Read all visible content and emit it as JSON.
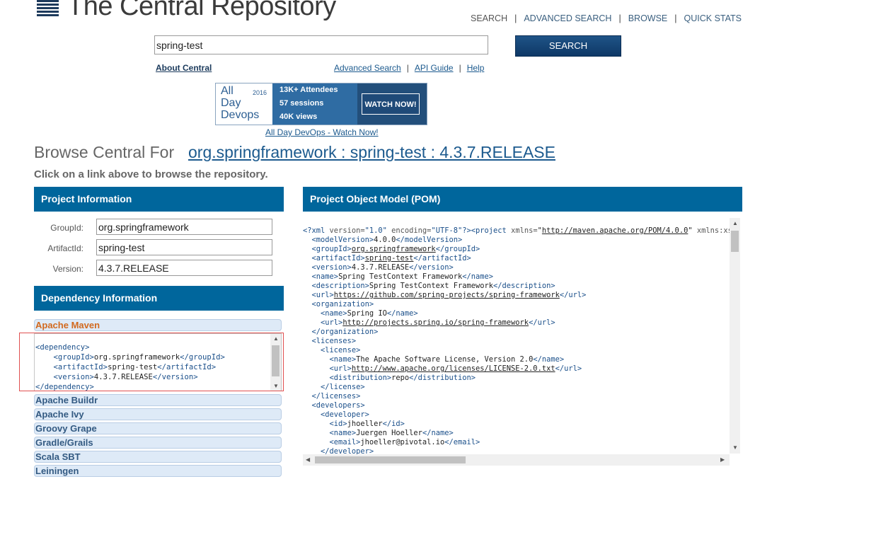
{
  "header": {
    "site_title": "The Central Repository",
    "nav": [
      "SEARCH",
      "ADVANCED SEARCH",
      "BROWSE",
      "QUICK STATS"
    ],
    "separator": "|"
  },
  "search": {
    "value": "spring-test",
    "button_label": "SEARCH",
    "about_link": "About Central",
    "links": [
      "Advanced Search",
      "API Guide",
      "Help"
    ]
  },
  "banner": {
    "brand_line1": "All",
    "brand_line2": "Day",
    "brand_line3": "Devops",
    "year": "2016",
    "stat1": "13K+ Attendees",
    "stat2": "57 sessions",
    "stat3": "40K views",
    "button": "WATCH NOW!",
    "caption": "All Day DevOps - Watch Now!"
  },
  "browse": {
    "prefix": "Browse Central For",
    "artifact_link": "org.springframework : spring-test : 4.3.7.RELEASE",
    "hint": "Click on a link above to browse the repository."
  },
  "project": {
    "header": "Project Information",
    "fields": [
      {
        "label": "GroupId:",
        "value": "org.springframework"
      },
      {
        "label": "ArtifactId:",
        "value": "spring-test"
      },
      {
        "label": "Version:",
        "value": "4.3.7.RELEASE"
      }
    ]
  },
  "dependency": {
    "header": "Dependency Information",
    "tools": [
      "Apache Maven",
      "Apache Buildr",
      "Apache Ivy",
      "Groovy Grape",
      "Gradle/Grails",
      "Scala SBT",
      "Leiningen"
    ],
    "maven_snippet": {
      "group_id": "org.springframework",
      "artifact_id": "spring-test",
      "version": "4.3.7.RELEASE"
    }
  },
  "pom": {
    "header": "Project Object Model (POM)",
    "xmlns": "http://maven.apache.org/POM/4.0.0",
    "model_version": "4.0.0",
    "group_id": "org.springframework",
    "artifact_id": "spring-test",
    "version": "4.3.7.RELEASE",
    "name": "Spring TestContext Framework",
    "description": "Spring TestContext Framework",
    "url": "https://github.com/spring-projects/spring-framework",
    "organization_name": "Spring IO",
    "organization_url": "http://projects.spring.io/spring-framework",
    "license_name": "The Apache Software License, Version 2.0",
    "license_url": "http://www.apache.org/licenses/LICENSE-2.0.txt",
    "license_distribution": "repo",
    "developer_id": "jhoeller",
    "developer_name": "Juergen Hoeller",
    "developer_email": "jhoeller@pivotal.io"
  }
}
